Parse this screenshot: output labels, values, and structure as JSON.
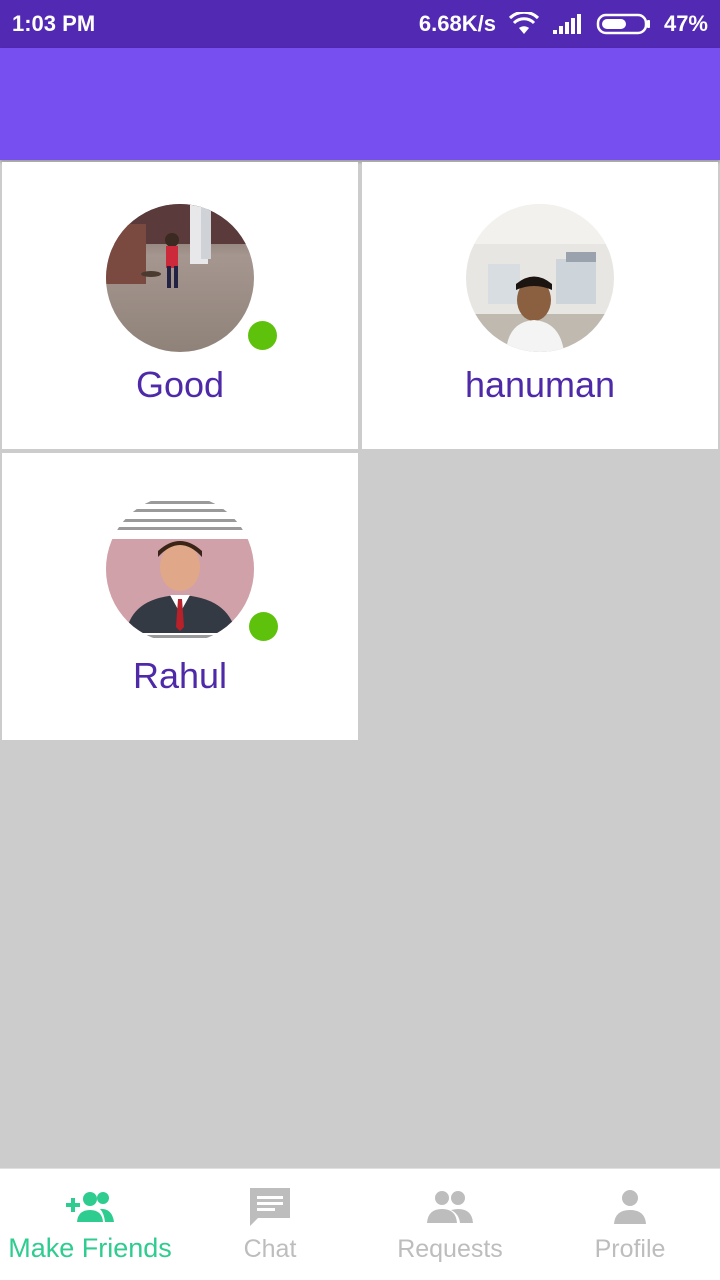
{
  "status_bar": {
    "time": "1:03 PM",
    "network_speed": "6.68K/s",
    "battery": "47%"
  },
  "friends": [
    {
      "name": "Good",
      "online": true
    },
    {
      "name": "hanuman",
      "online": false
    },
    {
      "name": "Rahul",
      "online": true
    }
  ],
  "bottom_nav": {
    "items": [
      {
        "label": "Make Friends",
        "icon": "add-friends-icon",
        "active": true
      },
      {
        "label": "Chat",
        "icon": "chat-icon",
        "active": false
      },
      {
        "label": "Requests",
        "icon": "people-icon",
        "active": false
      },
      {
        "label": "Profile",
        "icon": "person-icon",
        "active": false
      }
    ]
  },
  "colors": {
    "status_bar": "#5229b2",
    "app_bar": "#774ef0",
    "name_text": "#4e2aa8",
    "online": "#5ec20d",
    "nav_active": "#2ecc8f",
    "nav_inactive": "#bdbdbd"
  }
}
